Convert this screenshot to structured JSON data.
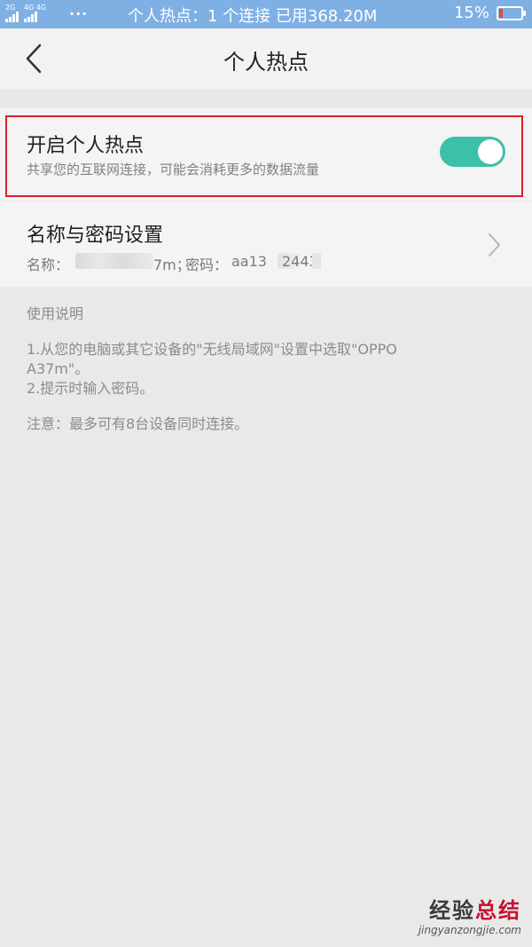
{
  "status_bar": {
    "signal_1_label": "2G",
    "signal_2_label": "4G 4G",
    "notification_dots": "···",
    "center_text": "个人热点：1 个连接   已用368.20M",
    "battery_percent": "15%",
    "battery_level": 0.15,
    "battery_color": "#e8463d"
  },
  "header": {
    "title": "个人热点"
  },
  "hotspot": {
    "title": "开启个人热点",
    "subtitle": "共享您的互联网连接，可能会消耗更多的数据流量",
    "enabled": true,
    "toggle_color": "#3bc1a5"
  },
  "name_password": {
    "title": "名称与密码设置",
    "name_label": "名称：",
    "name_visible_suffix": "7m；",
    "password_label": "密码：",
    "password_visible_prefix": "aa13",
    "password_visible_middle": "2443"
  },
  "instructions": {
    "heading": "使用说明",
    "line1": "1.从您的电脑或其它设备的\"无线局域网\"设置中选取\"OPPO",
    "line1b": "A37m\"。",
    "line2": "2.提示时输入密码。",
    "note": "注意：最多可有8台设备同时连接。"
  },
  "watermark": {
    "main_a": "经验",
    "main_b": "总结",
    "sub": "jingyanzongjie.com"
  }
}
